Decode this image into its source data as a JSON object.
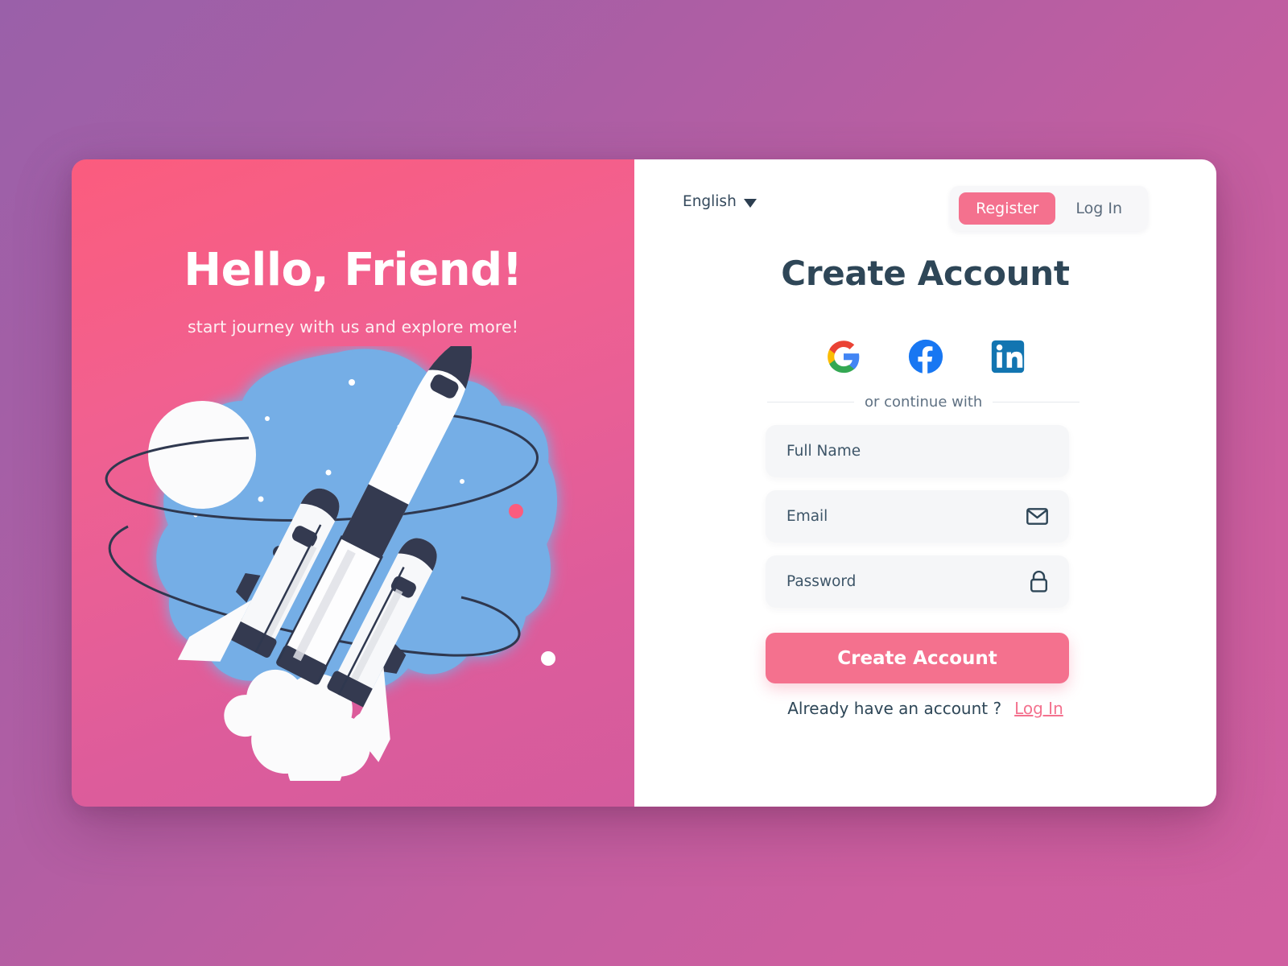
{
  "theme": {
    "accent_pink": "#f4718e",
    "hero_gradient_from": "#fb5c7e",
    "hero_gradient_to": "#d45b9d",
    "page_gradient_from": "#9a60a9",
    "page_gradient_to": "#d05fa0",
    "text_dark": "#2e4657",
    "field_bg": "#f5f6f8"
  },
  "hero": {
    "title": "Hello, Friend!",
    "subtitle": "start journey with us and explore more!",
    "illustration_name": "rocket-launch-illustration"
  },
  "topbar": {
    "language": {
      "label": "English",
      "caret_icon": "chevron-down-icon"
    },
    "toggle": {
      "register_label": "Register",
      "login_label": "Log In",
      "active": "Register"
    }
  },
  "form": {
    "title": "Create Account",
    "social": [
      {
        "name": "google",
        "icon": "google-icon",
        "label": "Google"
      },
      {
        "name": "facebook",
        "icon": "facebook-icon",
        "label": "Facebook"
      },
      {
        "name": "linkedin",
        "icon": "linkedin-icon",
        "label": "LinkedIn"
      }
    ],
    "divider_text": "or continue with",
    "fields": [
      {
        "name": "full-name",
        "placeholder": "Full Name",
        "value": "",
        "icon": null
      },
      {
        "name": "email",
        "placeholder": "Email",
        "value": "",
        "icon": "envelope-icon"
      },
      {
        "name": "password",
        "placeholder": "Password",
        "value": "",
        "icon": "lock-icon"
      }
    ],
    "submit_label": "Create Account",
    "footer": {
      "text": "Already have an account ?",
      "link_label": "Log In"
    }
  }
}
